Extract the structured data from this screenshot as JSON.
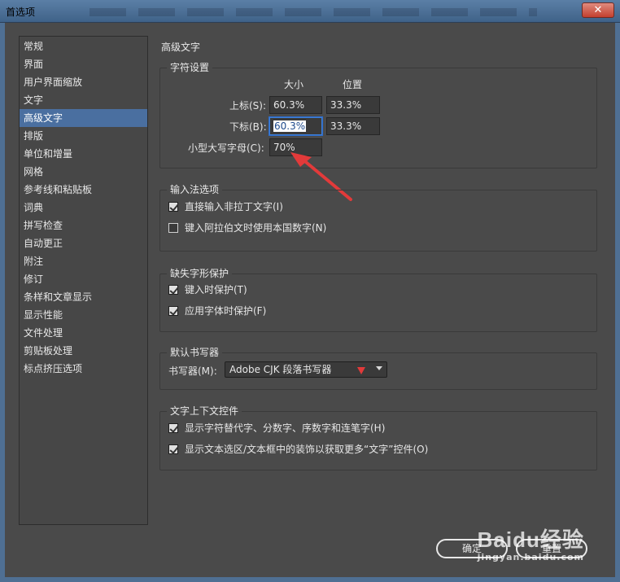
{
  "window": {
    "title": "首选项",
    "close_label": "✕"
  },
  "sidebar": {
    "items": [
      {
        "label": "常规"
      },
      {
        "label": "界面"
      },
      {
        "label": "用户界面缩放"
      },
      {
        "label": "文字"
      },
      {
        "label": "高级文字",
        "selected": true
      },
      {
        "label": "排版"
      },
      {
        "label": "单位和增量"
      },
      {
        "label": "网格"
      },
      {
        "label": "参考线和粘贴板"
      },
      {
        "label": "词典"
      },
      {
        "label": "拼写检查"
      },
      {
        "label": "自动更正"
      },
      {
        "label": "附注"
      },
      {
        "label": "修订"
      },
      {
        "label": "条样和文章显示"
      },
      {
        "label": "显示性能"
      },
      {
        "label": "文件处理"
      },
      {
        "label": "剪贴板处理"
      },
      {
        "label": "标点挤压选项"
      }
    ]
  },
  "main": {
    "title": "高级文字",
    "char_settings": {
      "legend": "字符设置",
      "col_size": "大小",
      "col_position": "位置",
      "superscript": {
        "label": "上标(S):",
        "size": "60.3%",
        "position": "33.3%"
      },
      "subscript": {
        "label": "下标(B):",
        "size": "60.3%",
        "position": "33.3%"
      },
      "small_caps": {
        "label": "小型大写字母(C):",
        "size": "70%"
      }
    },
    "input_method": {
      "legend": "输入法选项",
      "opt1": {
        "label": "直接输入非拉丁文字(I)",
        "checked": true
      },
      "opt2": {
        "label": "键入阿拉伯文时使用本国数字(N)",
        "checked": false
      }
    },
    "missing_glyph": {
      "legend": "缺失字形保护",
      "opt1": {
        "label": "键入时保护(T)",
        "checked": true
      },
      "opt2": {
        "label": "应用字体时保护(F)",
        "checked": true
      }
    },
    "composer": {
      "legend": "默认书写器",
      "label": "书写器(M):",
      "value": "Adobe CJK 段落书写器"
    },
    "context_controls": {
      "legend": "文字上下文控件",
      "opt1": {
        "label": "显示字符替代字、分数字、序数字和连笔字(H)",
        "checked": true
      },
      "opt2": {
        "label": "显示文本选区/文本框中的装饰以获取更多“文字”控件(O)",
        "checked": true
      }
    }
  },
  "buttons": {
    "ok": "确定",
    "reset": "重置"
  },
  "watermark": {
    "main": "Baidu经验",
    "sub": "jingyan.baidu.com"
  },
  "colors": {
    "accent_selected": "#4a6fa0",
    "annotation_red": "#e23a3a",
    "window_bg": "#4a4a4a"
  }
}
